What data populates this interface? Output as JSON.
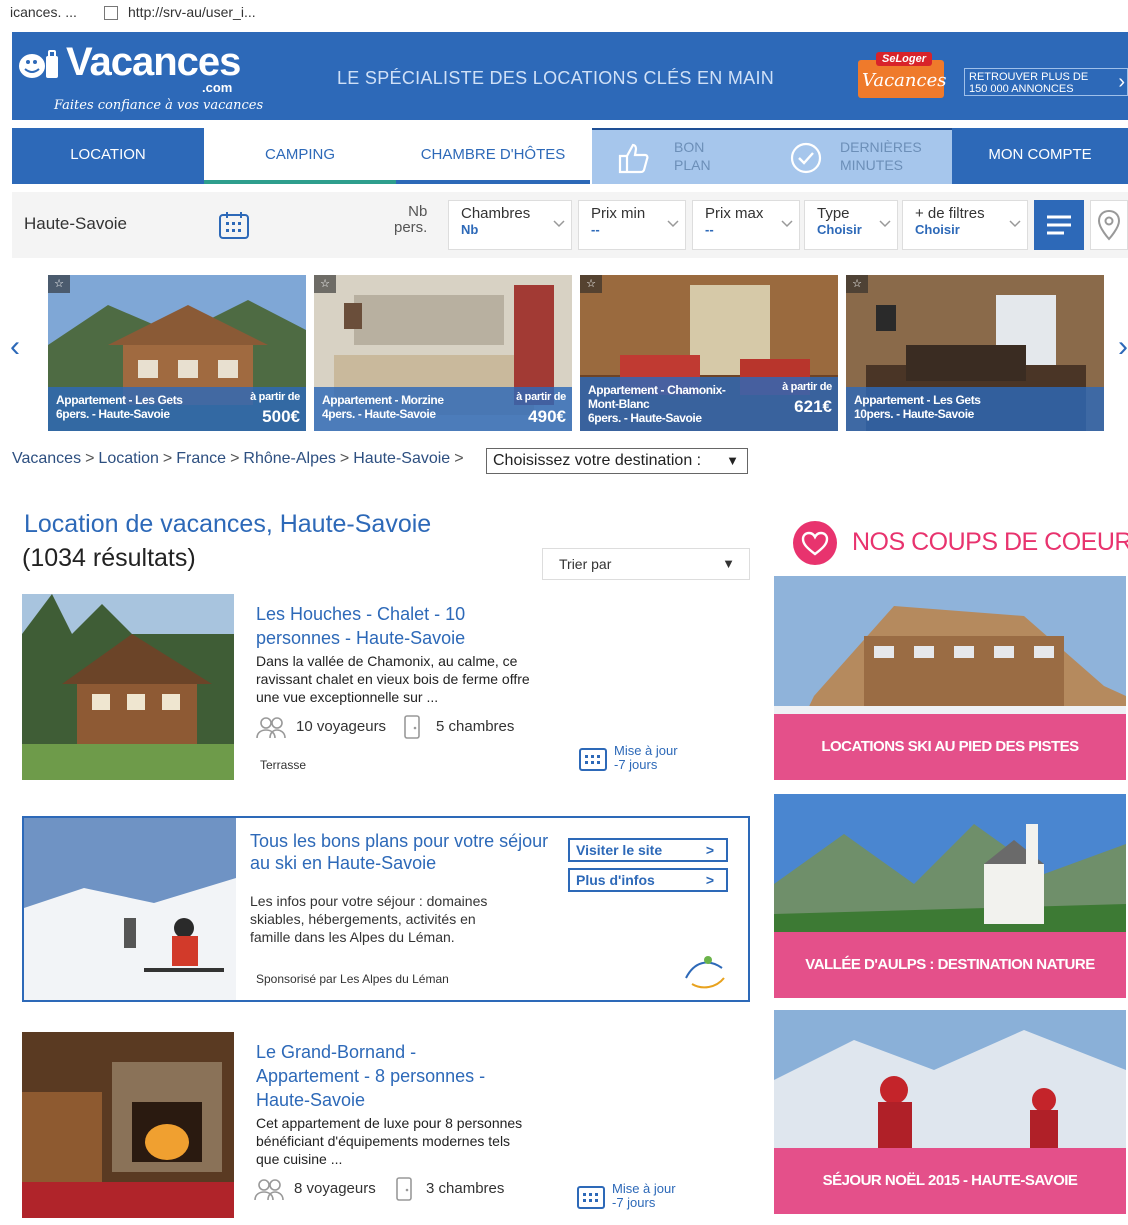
{
  "browser": {
    "tab_text": "icances. ...",
    "url_text": "http://srv-au/user_i..."
  },
  "header": {
    "logo_name": "Vacances",
    "logo_com": ".com",
    "logo_tagline": "Faites confiance à vos vacances",
    "slogan": "LE SPÉCIALISTE DES LOCATIONS CLÉS EN MAIN",
    "badge_top": "SeLoger",
    "badge_main": "Vacances",
    "cta_line1": "RETROUVER PLUS DE",
    "cta_line2": "150 000 ANNONCES",
    "cta_chevron": "›"
  },
  "nav": {
    "location": "LOCATION",
    "camping": "CAMPING",
    "chambre": "CHAMBRE D'HÔTES",
    "bonplan_1": "BON",
    "bonplan_2": "PLAN",
    "derniers_1": "DERNIÈRES",
    "derniers_2": "MINUTES",
    "compte": "MON COMPTE"
  },
  "search": {
    "destination": "Haute-Savoie",
    "nbpers_1": "Nb",
    "nbpers_2": "pers.",
    "filters": [
      {
        "label": "Chambres",
        "value": "Nb"
      },
      {
        "label": "Prix min",
        "value": "--"
      },
      {
        "label": "Prix max",
        "value": "--"
      },
      {
        "label": "Type",
        "value": "Choisir"
      },
      {
        "label": "+ de filtres",
        "value": "Choisir"
      }
    ]
  },
  "carousel": {
    "prev": "‹",
    "next": "›",
    "cards": [
      {
        "title_1": "Appartement - Les Gets",
        "title_2": "6pers. - Haute-Savoie",
        "from": "à partir de",
        "price": "500€"
      },
      {
        "title_1": "Appartement - Morzine",
        "title_2": "4pers. - Haute-Savoie",
        "from": "à partir de",
        "price": "490€"
      },
      {
        "title_1": "Appartement - Chamonix-",
        "title_2": "Mont-Blanc",
        "title_3": "6pers. - Haute-Savoie",
        "from": "à partir de",
        "price": "621€"
      },
      {
        "title_1": "Appartement - Les Gets",
        "title_2": "10pers. - Haute-Savoie",
        "from": "",
        "price": ""
      }
    ]
  },
  "breadcrumb": {
    "items": [
      "Vacances",
      "Location",
      "France",
      "Rhône-Alpes",
      "Haute-Savoie"
    ],
    "separator": ">",
    "select_label": "Choisissez votre destination :",
    "select_arrow": "▼"
  },
  "listing": {
    "title": "Location de vacances, Haute-Savoie",
    "count": "(1034 résultats)",
    "sort_label": "Trier par",
    "sort_arrow": "▼"
  },
  "results": [
    {
      "title_1": "Les Houches - Chalet - 10",
      "title_2": "personnes - Haute-Savoie",
      "desc": "Dans la vallée de Chamonix, au calme, ce ravissant chalet en vieux bois de ferme offre une vue exceptionnelle sur ...",
      "travelers": "10 voyageurs",
      "rooms": "5 chambres",
      "tag": "Terrasse",
      "update_1": "Mise à jour",
      "update_2": "-7 jours"
    },
    {
      "title_1": "Le Grand-Bornand -",
      "title_2": "Appartement - 8 personnes -",
      "title_3": "Haute-Savoie",
      "desc": "Cet appartement de luxe pour 8 personnes bénéficiant d'équipements modernes tels que cuisine ...",
      "travelers": "8 voyageurs",
      "rooms": "3 chambres",
      "update_1": "Mise à jour",
      "update_2": "-7 jours"
    }
  ],
  "sponsored": {
    "title": "Tous les bons plans pour votre séjour au ski en Haute-Savoie",
    "desc": "Les infos pour votre séjour : domaines skiables, hébergements, activités en famille dans les Alpes du Léman.",
    "footer": "Sponsorisé par Les Alpes du Léman",
    "btn_visit": "Visiter le site",
    "btn_info": "Plus d'infos",
    "chevron": ">"
  },
  "sidebar": {
    "title": "NOS COUPS DE COEUR",
    "promos": [
      "LOCATIONS SKI AU PIED DES PISTES",
      "VALLÉE D'AULPS : DESTINATION NATURE",
      "SÉJOUR NOËL 2015 - HAUTE-SAVOIE"
    ]
  },
  "colors": {
    "brand_blue": "#2d69b8",
    "pink": "#e4508a",
    "heart": "#e8336e",
    "orange": "#ef7a2b"
  }
}
